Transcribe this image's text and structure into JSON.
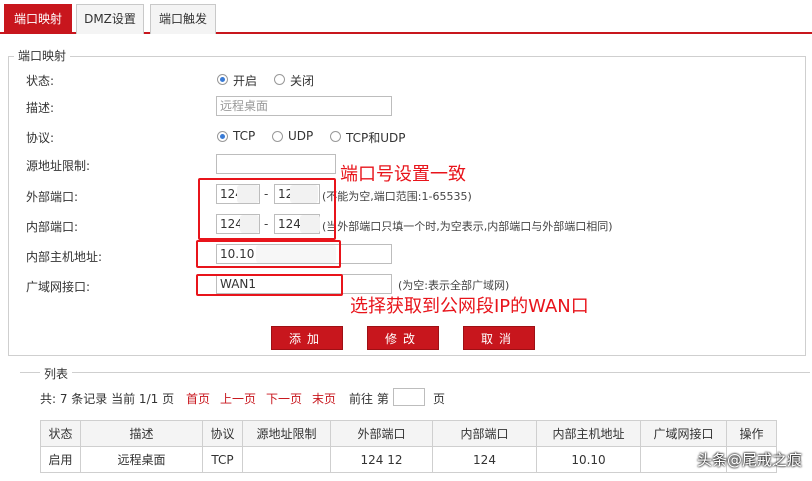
{
  "tabs": [
    {
      "label": "端口映射",
      "active": true
    },
    {
      "label": "DMZ设置",
      "active": false
    },
    {
      "label": "端口触发",
      "active": false
    }
  ],
  "section_title": "端口映射",
  "form": {
    "status_label": "状态:",
    "status_on": "开启",
    "status_off": "关闭",
    "desc_label": "描述:",
    "desc_placeholder": "远程桌面",
    "protocol_label": "协议:",
    "proto_tcp": "TCP",
    "proto_udp": "UDP",
    "proto_both": "TCP和UDP",
    "src_label": "源地址限制:",
    "ext_label": "外部端口:",
    "ext_from": "124",
    "ext_to": "12",
    "ext_hint": "(不能为空,端口范围:1-65535)",
    "int_label": "内部端口:",
    "int_from": "124",
    "int_to": "124",
    "int_hint": "(当外部端口只填一个时,为空表示,内部端口与外部端口相同)",
    "host_label": "内部主机地址:",
    "host_value": "10.10",
    "wan_label": "广域网接口:",
    "wan_value": "WAN1",
    "wan_hint": "(为空:表示全部广域网)",
    "dash": "-"
  },
  "annotations": {
    "port_note": "端口号设置一致",
    "wan_note": "选择获取到公网段IP的WAN口"
  },
  "buttons": {
    "add": "添加",
    "edit": "修改",
    "cancel": "取消"
  },
  "list": {
    "title": "列表",
    "summary": "共: 7 条记录 当前 1/1 页",
    "first": "首页",
    "prev": "上一页",
    "next": "下一页",
    "last": "末页",
    "goto_prefix": "前往 第",
    "goto_suffix": "页",
    "columns": [
      "状态",
      "描述",
      "协议",
      "源地址限制",
      "外部端口",
      "内部端口",
      "内部主机地址",
      "广域网接口",
      "操作"
    ],
    "rows": [
      {
        "status": "启用",
        "desc": "远程桌面",
        "proto": "TCP",
        "src": "",
        "ext": "124   12",
        "int": "124",
        "host": "10.10",
        "wan": "",
        "op": ""
      }
    ]
  },
  "watermark": "头条@尾戒之痕",
  "colors": {
    "accent": "#c8161d",
    "annotation": "#e8141b",
    "radio": "#3a7bd5"
  }
}
